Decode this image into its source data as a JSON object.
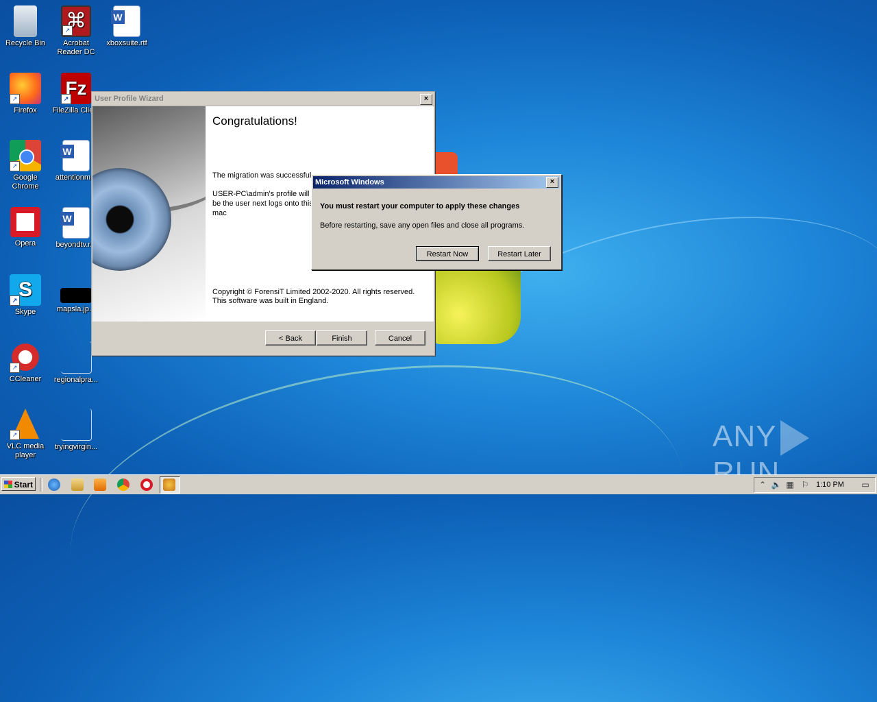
{
  "desktop": {
    "icons": [
      {
        "label": "Recycle Bin"
      },
      {
        "label": "Acrobat Reader DC"
      },
      {
        "label": "xboxsuite.rtf"
      },
      {
        "label": "Firefox"
      },
      {
        "label": "FileZilla Clie..."
      },
      {
        "label": "Google Chrome"
      },
      {
        "label": "attentionm..."
      },
      {
        "label": "Opera"
      },
      {
        "label": "beyondtv.r..."
      },
      {
        "label": "Skype"
      },
      {
        "label": "mapsla.jp..."
      },
      {
        "label": "CCleaner"
      },
      {
        "label": "regionalpra..."
      },
      {
        "label": "VLC media player"
      },
      {
        "label": "tryingvirgin..."
      }
    ]
  },
  "wizard": {
    "title": "User Profile Wizard",
    "heading": "Congratulations!",
    "message1": "The migration was successful.",
    "message2": "USER-PC\\admin's profile will be the user next logs onto this mac",
    "copyright1": "Copyright © ForensiT Limited 2002-2020. All rights reserved.",
    "copyright2": "This software was built in England.",
    "buttons": {
      "back": "< Back",
      "finish": "Finish",
      "cancel": "Cancel"
    },
    "close_glyph": "×"
  },
  "msgbox": {
    "title": "Microsoft Windows",
    "heading": "You must restart your computer to apply these changes",
    "body": "Before restarting, save any open files and close all programs.",
    "buttons": {
      "restart_now": "Restart Now",
      "restart_later": "Restart Later"
    },
    "close_glyph": "×"
  },
  "taskbar": {
    "start_label": "Start",
    "clock": "1:10 PM"
  },
  "watermark": {
    "left": "ANY",
    "right": "RUN"
  }
}
